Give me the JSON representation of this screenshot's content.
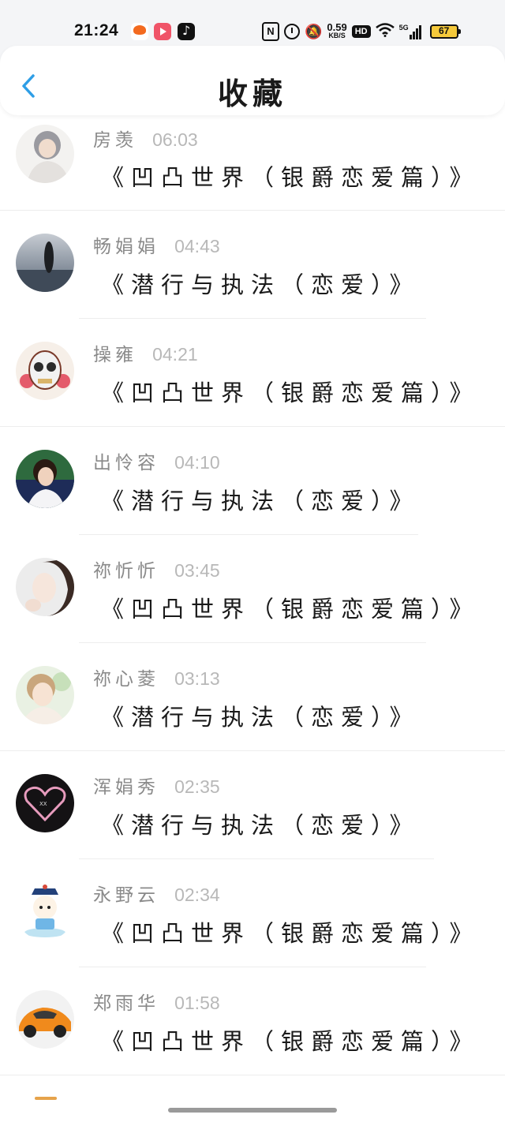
{
  "status_bar": {
    "time": "21:24",
    "net_speed_value": "0.59",
    "net_speed_unit": "KB/S",
    "hd_label": "HD",
    "signal_label": "5G",
    "battery_level": "67",
    "icons": [
      "app-notification-icon",
      "video-app-icon",
      "tiktok-icon",
      "nfc-icon",
      "alarm-icon",
      "mute-icon",
      "hd-icon",
      "wifi-icon",
      "signal-icon",
      "battery-icon"
    ]
  },
  "header": {
    "title": "收藏",
    "back_icon": "chevron-left-icon",
    "accent_color": "#2e9ee6"
  },
  "favorites": [
    {
      "name": "房羡",
      "time": "06:03",
      "title": "《凹凸世界（银爵恋爱篇）》"
    },
    {
      "name": "畅娟娟",
      "time": "04:43",
      "title": "《潜行与执法（恋爱）》"
    },
    {
      "name": "操雍",
      "time": "04:21",
      "title": "《凹凸世界（银爵恋爱篇）》"
    },
    {
      "name": "出怜容",
      "time": "04:10",
      "title": "《潜行与执法（恋爱）》"
    },
    {
      "name": "祢忻忻",
      "time": "03:45",
      "title": "《凹凸世界（银爵恋爱篇）》"
    },
    {
      "name": "祢心菱",
      "time": "03:13",
      "title": "《潜行与执法（恋爱）》"
    },
    {
      "name": "浑娟秀",
      "time": "02:35",
      "title": "《潜行与执法（恋爱）》"
    },
    {
      "name": "永野云",
      "time": "02:34",
      "title": "《凹凸世界（银爵恋爱篇）》"
    },
    {
      "name": "郑雨华",
      "time": "01:58",
      "title": "《凹凸世界（银爵恋爱篇）》"
    }
  ]
}
